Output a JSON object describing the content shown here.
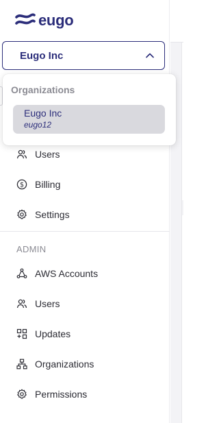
{
  "brand": {
    "name": "eugo",
    "color": "#2b2d7a"
  },
  "org_selector": {
    "current": "Eugo Inc"
  },
  "org_dropdown": {
    "heading": "Organizations",
    "options": [
      {
        "name": "Eugo Inc",
        "slug": "eugo12",
        "selected": true
      }
    ]
  },
  "nav": {
    "items": [
      {
        "label": "Users",
        "icon": "users-icon"
      },
      {
        "label": "Billing",
        "icon": "dollar-circle-icon"
      },
      {
        "label": "Settings",
        "icon": "gear-icon"
      }
    ]
  },
  "admin": {
    "title": "ADMIN",
    "items": [
      {
        "label": "AWS Accounts",
        "icon": "network-icon"
      },
      {
        "label": "Users",
        "icon": "users-icon"
      },
      {
        "label": "Updates",
        "icon": "updates-grid-icon"
      },
      {
        "label": "Organizations",
        "icon": "org-chart-icon"
      },
      {
        "label": "Permissions",
        "icon": "gear-icon"
      }
    ]
  }
}
